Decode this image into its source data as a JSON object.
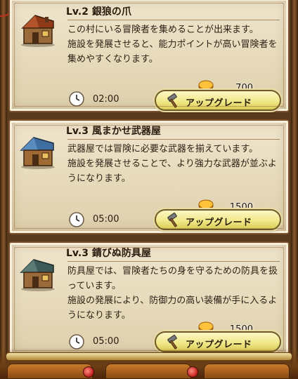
{
  "buildings": [
    {
      "title": "Lv.2 銀狼の爪",
      "desc_lines": [
        "この村にいる冒険者を集めることが出来ます。",
        "施設を発展させると、能力ポイントが高い冒険者を集めやすくなります。"
      ],
      "time": "02:00",
      "cost": "700",
      "button_label": "アップグレード",
      "roof_color": "#a2401c"
    },
    {
      "title": "Lv.3 風まかせ武器屋",
      "desc_lines": [
        "武器屋では冒険に必要な武器を揃えています。",
        "施設を発展させることで、より強力な武器が並ぶようになります。"
      ],
      "time": "05:00",
      "cost": "1500",
      "button_label": "アップグレード",
      "roof_color": "#3f6fa0"
    },
    {
      "title": "Lv.3 錆びぬ防具屋",
      "desc_lines": [
        "防具屋では、冒険者たちの身を守るための防具を扱っています。",
        "施設の発展により、防御力の高い装備が手に入るようになります。"
      ],
      "time": "05:00",
      "cost": "1500",
      "button_label": "アップグレード",
      "roof_color": "#3e5a58"
    }
  ]
}
